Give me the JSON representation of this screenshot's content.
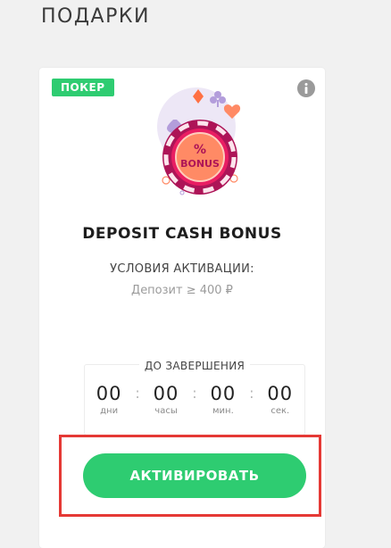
{
  "header": {
    "title": "ПОДАРКИ"
  },
  "card": {
    "badge": "ПОКЕР",
    "info_icon": "info-icon",
    "illustration": {
      "icon": "poker-chip-bonus-icon",
      "chip_symbol": "%",
      "chip_text": "BONUS",
      "colors": {
        "chip_outer": "#c2185b",
        "chip_inner": "#e91e63",
        "chip_center": "#ff8a65",
        "accent_purple": "#b39ddb",
        "accent_orange": "#ff7043"
      }
    },
    "title": "DEPOSIT CASH BONUS",
    "conditions": {
      "label": "УСЛОВИЯ АКТИВАЦИИ:",
      "value": "Депозит ≥ 400 ₽"
    },
    "timer": {
      "label": "ДО ЗАВЕРШЕНИЯ",
      "units": [
        {
          "value": "00",
          "caption": "дни"
        },
        {
          "value": "00",
          "caption": "часы"
        },
        {
          "value": "00",
          "caption": "мин."
        },
        {
          "value": "00",
          "caption": "сек."
        }
      ],
      "separator": ":"
    },
    "activate_label": "АКТИВИРОВАТЬ"
  },
  "colors": {
    "accent_green": "#2ecc71",
    "highlight_red": "#e53935",
    "background": "#f1f1f1"
  }
}
